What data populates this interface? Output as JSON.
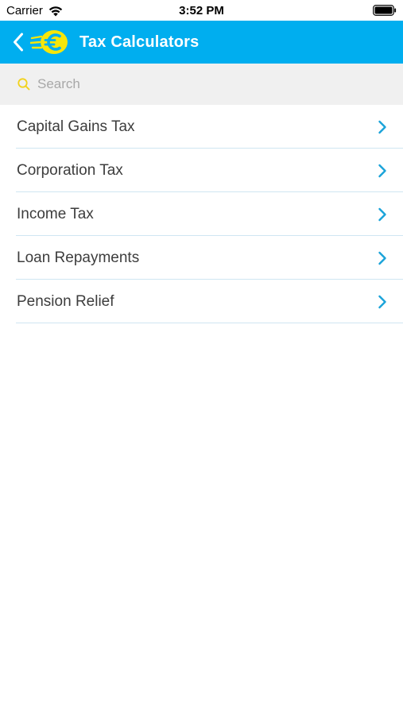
{
  "status_bar": {
    "carrier": "Carrier",
    "time": "3:52 PM",
    "wifi_icon": "wifi-icon",
    "battery_icon": "battery-icon"
  },
  "nav_bar": {
    "title": "Tax Calculators",
    "back_icon": "chevron-left-icon",
    "logo_icon": "euro-logo-icon",
    "background_color": "#00aeef"
  },
  "search": {
    "placeholder": "Search",
    "value": "",
    "icon": "search-icon",
    "icon_color": "#f2d21b"
  },
  "list": {
    "items": [
      {
        "label": "Capital Gains Tax"
      },
      {
        "label": "Corporation Tax"
      },
      {
        "label": "Income Tax"
      },
      {
        "label": "Loan Repayments"
      },
      {
        "label": "Pension Relief"
      }
    ],
    "chevron_icon": "chevron-right-icon",
    "accent_color": "#1aa3d9"
  }
}
